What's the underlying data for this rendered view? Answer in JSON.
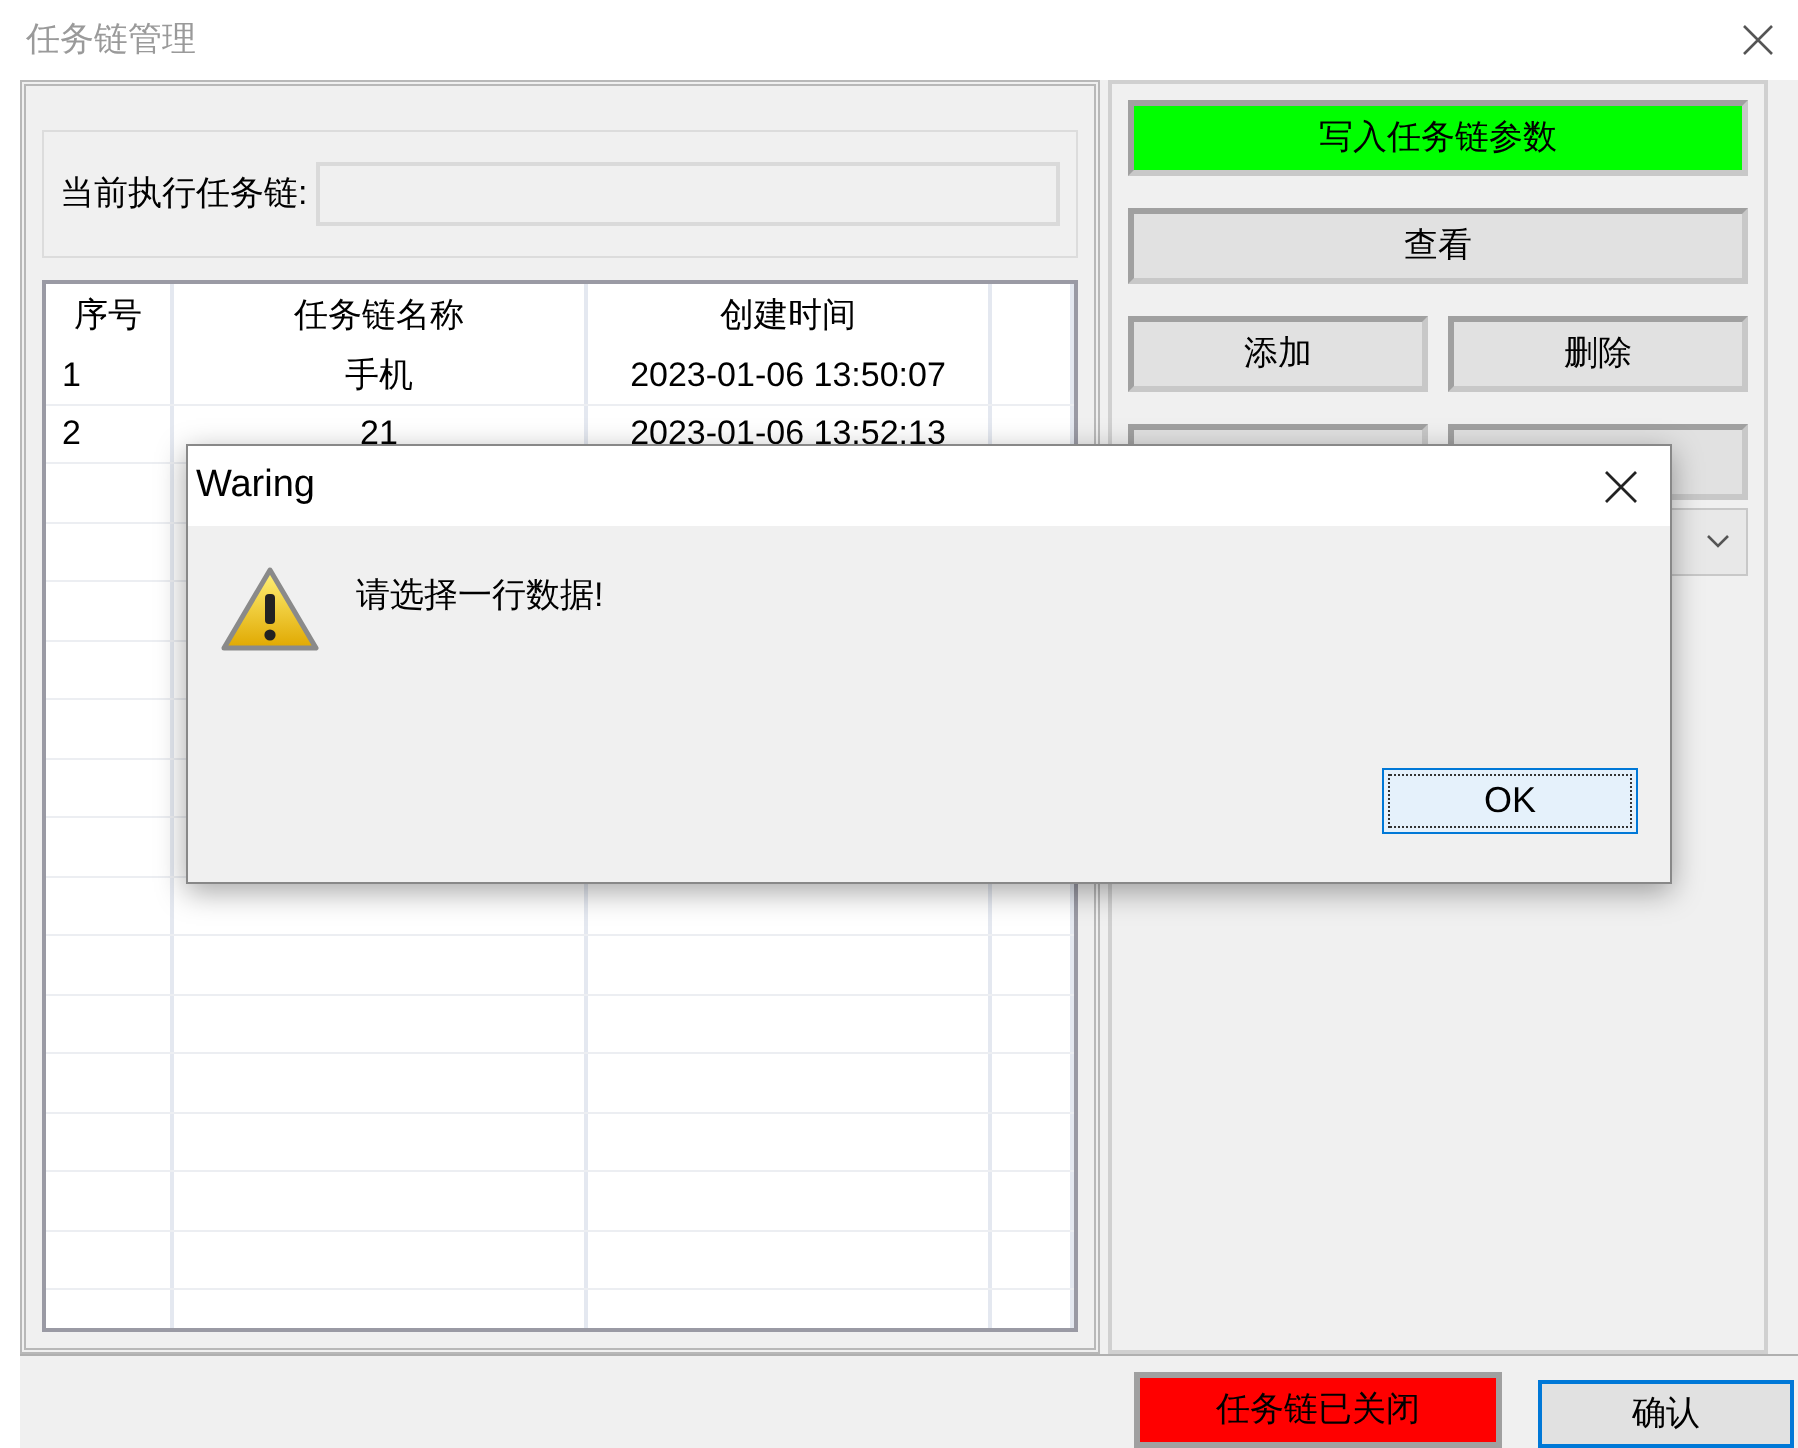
{
  "window": {
    "title": "任务链管理"
  },
  "current_chain": {
    "label": "当前执行任务链:"
  },
  "table": {
    "columns": [
      "序号",
      "任务链名称",
      "创建时间"
    ],
    "rows": [
      [
        "1",
        "手机",
        "2023-01-06 13:50:07"
      ],
      [
        "2",
        "21",
        "2023-01-06 13:52:13"
      ]
    ]
  },
  "actions": {
    "write": {
      "label": "写入任务链参数",
      "color": "#00ff00"
    },
    "view": {
      "label": "查看"
    },
    "add": {
      "label": "添加"
    },
    "delete": {
      "label": "删除"
    }
  },
  "bottom": {
    "status": {
      "label": "任务链已关闭",
      "color": "#ff0000"
    },
    "confirm": {
      "label": "确认"
    }
  },
  "dialog": {
    "title": "Waring",
    "message": "请选择一行数据!",
    "ok": "OK"
  }
}
